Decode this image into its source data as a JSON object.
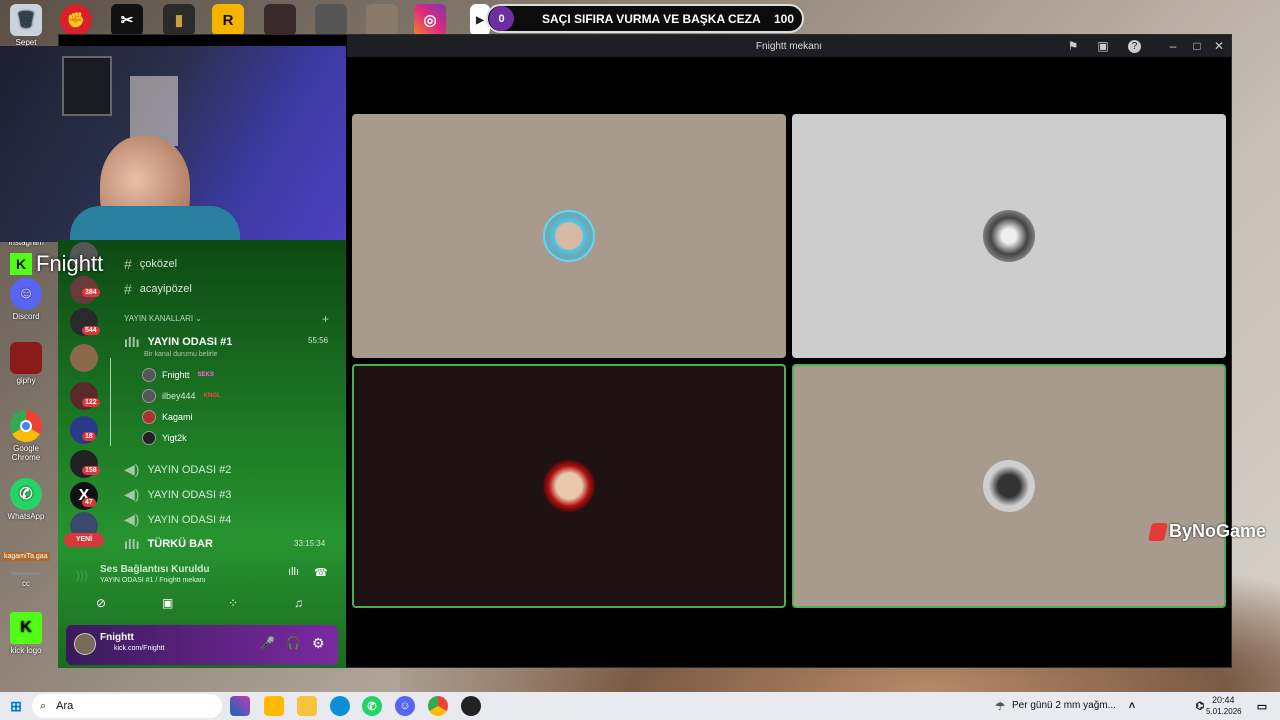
{
  "desktop": {
    "icons": [
      {
        "label": "Sepet",
        "icon": "recycle-bin-icon",
        "color": "#c9d2dd"
      },
      {
        "label": "Instagram",
        "icon": "instagram-icon",
        "color": "#c13584"
      },
      {
        "label": "Discord",
        "icon": "discord-icon",
        "color": "#5865f2"
      },
      {
        "label": "giphy",
        "icon": "giphy-icon",
        "color": "#8b1a1a"
      },
      {
        "label": "Google Chrome",
        "icon": "chrome-icon",
        "color": "#1a73e8"
      },
      {
        "label": "WhatsApp",
        "icon": "whatsapp-icon",
        "color": "#25d366"
      },
      {
        "label": "kagamiTa.gaa",
        "icon": "file-icon",
        "color": "#b06a2a"
      },
      {
        "label": "cc",
        "icon": "file-icon",
        "color": "#6a6a6a"
      },
      {
        "label": "kick logo",
        "icon": "kick-icon",
        "color": "#53fc18"
      }
    ]
  },
  "poll": {
    "left_value": "0",
    "title": "SAÇI SIFIRA VURMA VE BAŞKA CEZA",
    "right_value": "100"
  },
  "window": {
    "title": "Fnightt mekanı"
  },
  "overlay": {
    "streamer_name": "Fnightt",
    "brand": "ByNoGame"
  },
  "servers": {
    "badges": [
      "384",
      "544",
      "122",
      "18",
      "158",
      "47"
    ],
    "new_label": "YENİ"
  },
  "channels": {
    "text": [
      "çoközel",
      "acayipözel"
    ],
    "category": "YAYIN KANALLARI",
    "active_voice": {
      "name": "YAYIN ODASI #1",
      "timer": "55:56",
      "status": "Bir kanal durumu belirle"
    },
    "members": [
      {
        "name": "Fnightt",
        "tag": "SEKS",
        "tag_color": "#ff6ad5"
      },
      {
        "name": "ilbey444",
        "tag": "KNGL",
        "tag_color": "#ff4040"
      },
      {
        "name": "Kagami",
        "tag": "",
        "tag_color": ""
      },
      {
        "name": "Yigt2k",
        "tag": "",
        "tag_color": ""
      }
    ],
    "voice": [
      "YAYIN ODASI #2",
      "YAYIN ODASI #3",
      "YAYIN ODASI #4"
    ],
    "last_voice": {
      "name": "TÜRKÜ BAR",
      "timer": "33:15:34"
    }
  },
  "voice_panel": {
    "status": "Ses Bağlantısı Kuruldu",
    "location": "YAYIN ODASI #1 / Fnightt mekanı"
  },
  "user_panel": {
    "name": "Fnightt",
    "status": "kick.com/Fnightt"
  },
  "taskbar": {
    "search": "Ara",
    "weather": "Per günü 2 mm yağm...",
    "time": "20:44",
    "date": "5.01.2026"
  }
}
